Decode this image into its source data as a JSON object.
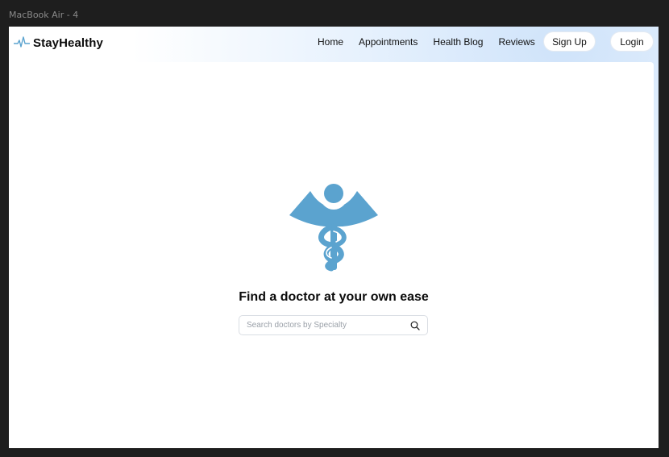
{
  "frame": {
    "label": "MacBook Air - 4"
  },
  "brand": {
    "name": "StayHealthy",
    "icon": "heartbeat-icon",
    "accent_color": "#5ba3cf"
  },
  "nav": {
    "links": [
      "Home",
      "Appointments",
      "Health Blog",
      "Reviews"
    ],
    "signup_label": "Sign Up",
    "login_label": "Login"
  },
  "hero": {
    "icon": "caduceus-icon",
    "title": "Find a doctor at your own ease"
  },
  "search": {
    "placeholder": "Search doctors by Specialty",
    "value": "",
    "icon": "search-icon"
  }
}
